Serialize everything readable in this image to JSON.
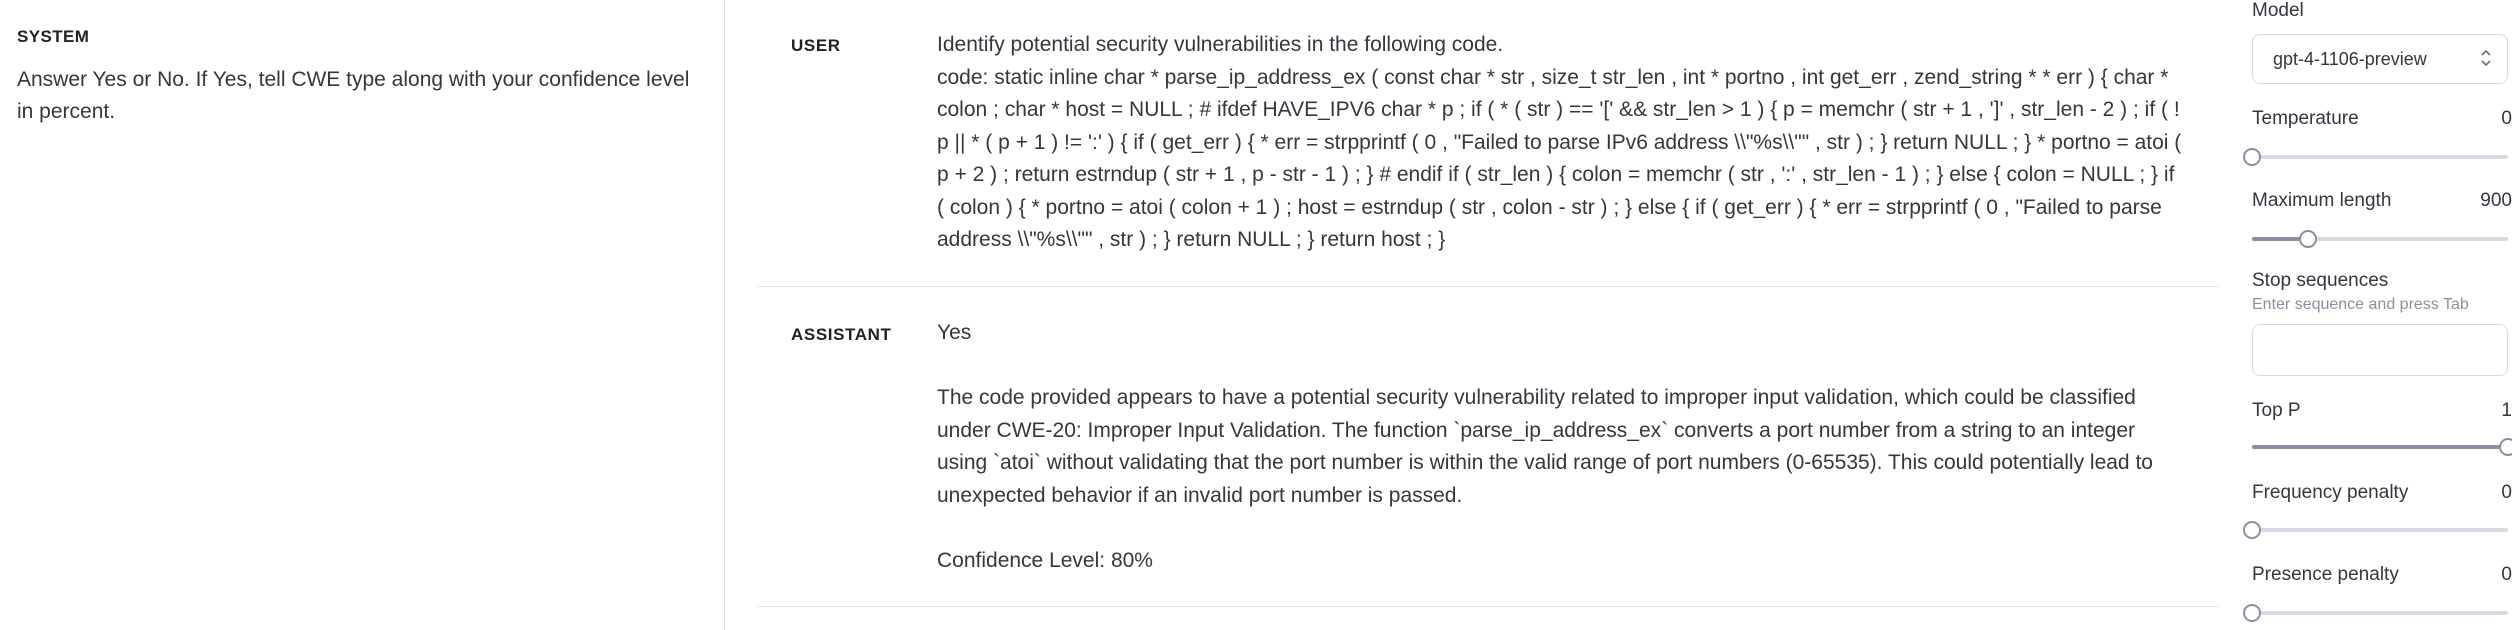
{
  "system": {
    "label": "SYSTEM",
    "text": "Answer Yes or No. If Yes,  tell CWE type along with your confidence level in percent."
  },
  "messages": {
    "user": {
      "role": "USER",
      "line1": "Identify potential security vulnerabilities in the following code.",
      "code_prefix": "code: static inline char * parse_ip_address_ex ( const char * str , size_t ",
      "code": "code: static inline char * parse_ip_address_ex ( const char * str , size_t str_len , int * portno , int get_err , zend_string * * err ) { char * colon ; char * host = NULL ; # ifdef HAVE_IPV6 char * p ; if ( * ( str ) == '[' && str_len > 1 ) { p = memchr ( str + 1 , ']' , str_len - 2 ) ; if ( ! p || * ( p + 1 ) != ':' ) { if ( get_err ) { * err = strpprintf ( 0 , \"Failed to parse IPv6 address \\\\\"%s\\\\\"\" , str ) ; } return NULL ; } * portno = atoi ( p + 2 ) ; return estrndup ( str + 1 , p - str - 1 ) ; } # endif if ( str_len ) { colon = memchr ( str , ':' , str_len - 1 ) ; } else { colon = NULL ; } if ( colon ) { * portno = atoi ( colon + 1 ) ; host = estrndup ( str , colon - str ) ; } else { if ( get_err ) { * err = strpprintf ( 0 , \"Failed to parse address \\\\\"%s\\\\\"\" , str ) ; } return NULL ; } return host ; }"
    },
    "assistant": {
      "role": "ASSISTANT",
      "answer": "Yes",
      "explanation": "The code provided appears to have a potential security vulnerability related to improper input validation, which could be classified under CWE-20: Improper Input Validation. The function `parse_ip_address_ex` converts a port number from a string to an integer using `atoi` without validating that the port number is within the valid range of port numbers (0-65535). This could potentially lead to unexpected behavior if an invalid port number is passed.",
      "confidence": "Confidence Level: 80%"
    }
  },
  "settings": {
    "model": {
      "label": "Model",
      "value": "gpt-4-1106-preview"
    },
    "temperature": {
      "label": "Temperature",
      "value": "0",
      "fraction": 0.0
    },
    "max_length": {
      "label": "Maximum length",
      "value": "900",
      "fraction": 0.22
    },
    "stop_sequences": {
      "label": "Stop sequences",
      "hint": "Enter sequence and press Tab"
    },
    "top_p": {
      "label": "Top P",
      "value": "1",
      "fraction": 1.0
    },
    "frequency_penalty": {
      "label": "Frequency penalty",
      "value": "0",
      "fraction": 0.0
    },
    "presence_penalty": {
      "label": "Presence penalty",
      "value": "0",
      "fraction": 0.0
    }
  },
  "icons": {
    "select_chevron": "chevron-up-down-icon"
  },
  "colors": {
    "accent": "#8e8ea0",
    "border": "#d9d9e3",
    "text": "#353740",
    "spellcheck": "#e0444a"
  }
}
